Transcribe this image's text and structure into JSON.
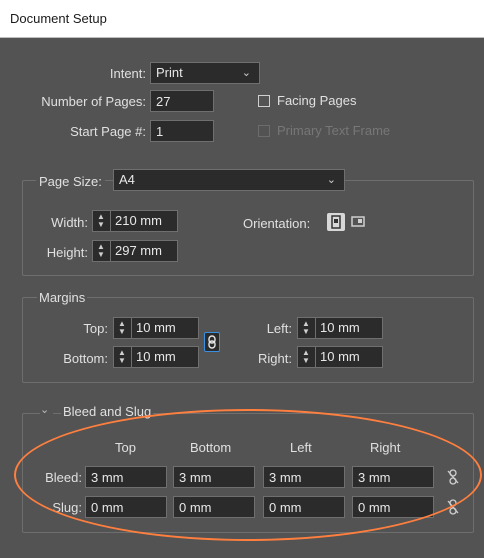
{
  "window": {
    "title": "Document Setup"
  },
  "intent": {
    "label": "Intent:",
    "value": "Print"
  },
  "pages": {
    "number_label": "Number of Pages:",
    "number_value": "27",
    "start_label": "Start Page #:",
    "start_value": "1",
    "facing_label": "Facing Pages",
    "primary_label": "Primary Text Frame"
  },
  "page_size": {
    "label": "Page Size:",
    "value": "A4",
    "width_label": "Width:",
    "width_value": "210 mm",
    "height_label": "Height:",
    "height_value": "297 mm",
    "orientation_label": "Orientation:"
  },
  "margins": {
    "title": "Margins",
    "top_label": "Top:",
    "top_value": "10 mm",
    "bottom_label": "Bottom:",
    "bottom_value": "10 mm",
    "left_label": "Left:",
    "left_value": "10 mm",
    "right_label": "Right:",
    "right_value": "10 mm"
  },
  "bleed_slug": {
    "title": "Bleed and Slug",
    "col_top": "Top",
    "col_bottom": "Bottom",
    "col_left": "Left",
    "col_right": "Right",
    "bleed_label": "Bleed:",
    "bleed": [
      "3 mm",
      "3 mm",
      "3 mm",
      "3 mm"
    ],
    "slug_label": "Slug:",
    "slug": [
      "0 mm",
      "0 mm",
      "0 mm",
      "0 mm"
    ]
  },
  "colors": {
    "annotation": "#ff7f3f",
    "background": "#535353",
    "field": "#2b2b2b"
  },
  "icons": [
    "chevron-down-icon",
    "portrait-orientation-icon",
    "landscape-orientation-icon",
    "link-icon",
    "broken-link-icon",
    "collapse-chevron-icon"
  ]
}
